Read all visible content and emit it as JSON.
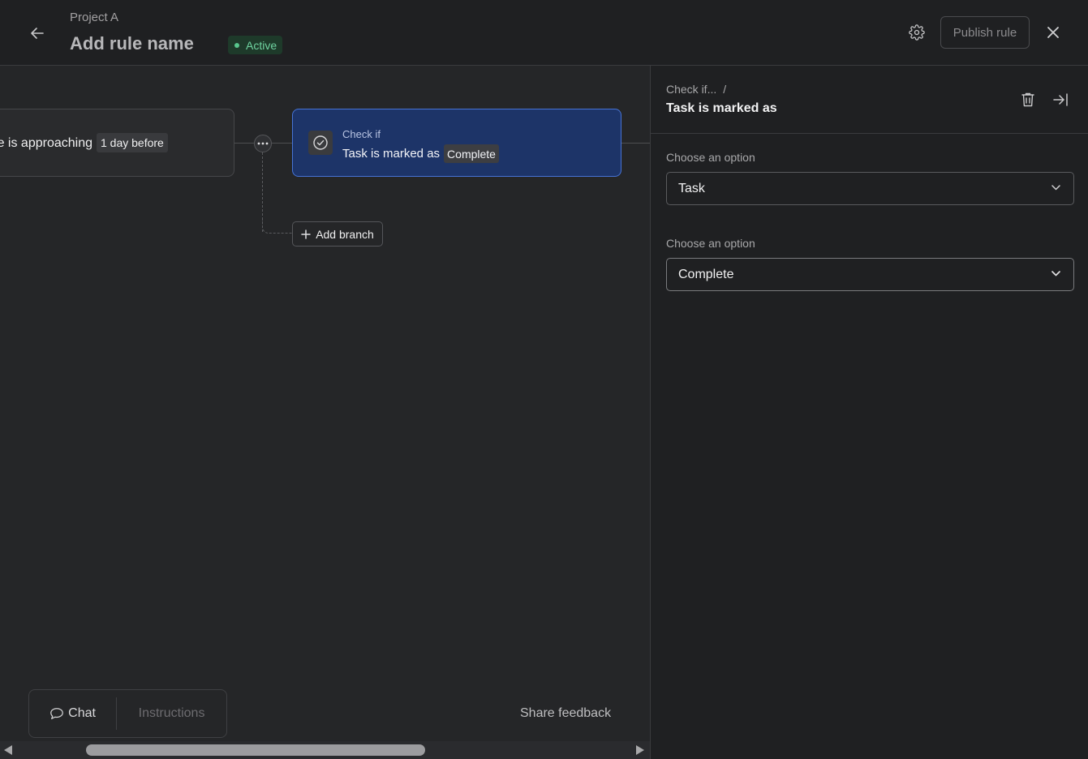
{
  "header": {
    "project_name": "Project A",
    "rule_name": "Add rule name",
    "status": "Active",
    "publish_label": "Publish rule"
  },
  "canvas": {
    "trigger": {
      "text": "Due date is approaching",
      "chip": "1 day before"
    },
    "condition": {
      "eyebrow": "Check if",
      "title": "Task is marked as",
      "chip": "Complete"
    },
    "add_branch_label": "Add branch",
    "toolbar": {
      "chat_label": "Chat",
      "instructions_label": "Instructions"
    },
    "share_feedback_label": "Share feedback"
  },
  "panel": {
    "breadcrumb": {
      "parent": "Check if...",
      "separator": "/"
    },
    "title": "Task is marked as",
    "fields": [
      {
        "label": "Choose an option",
        "value": "Task"
      },
      {
        "label": "Choose an option",
        "value": "Complete"
      }
    ]
  },
  "colors": {
    "background": "#252628",
    "header": "#1f2022",
    "accent_card": "#1d3468",
    "accent_border": "#4673d6",
    "status_green": "#58c78d"
  }
}
